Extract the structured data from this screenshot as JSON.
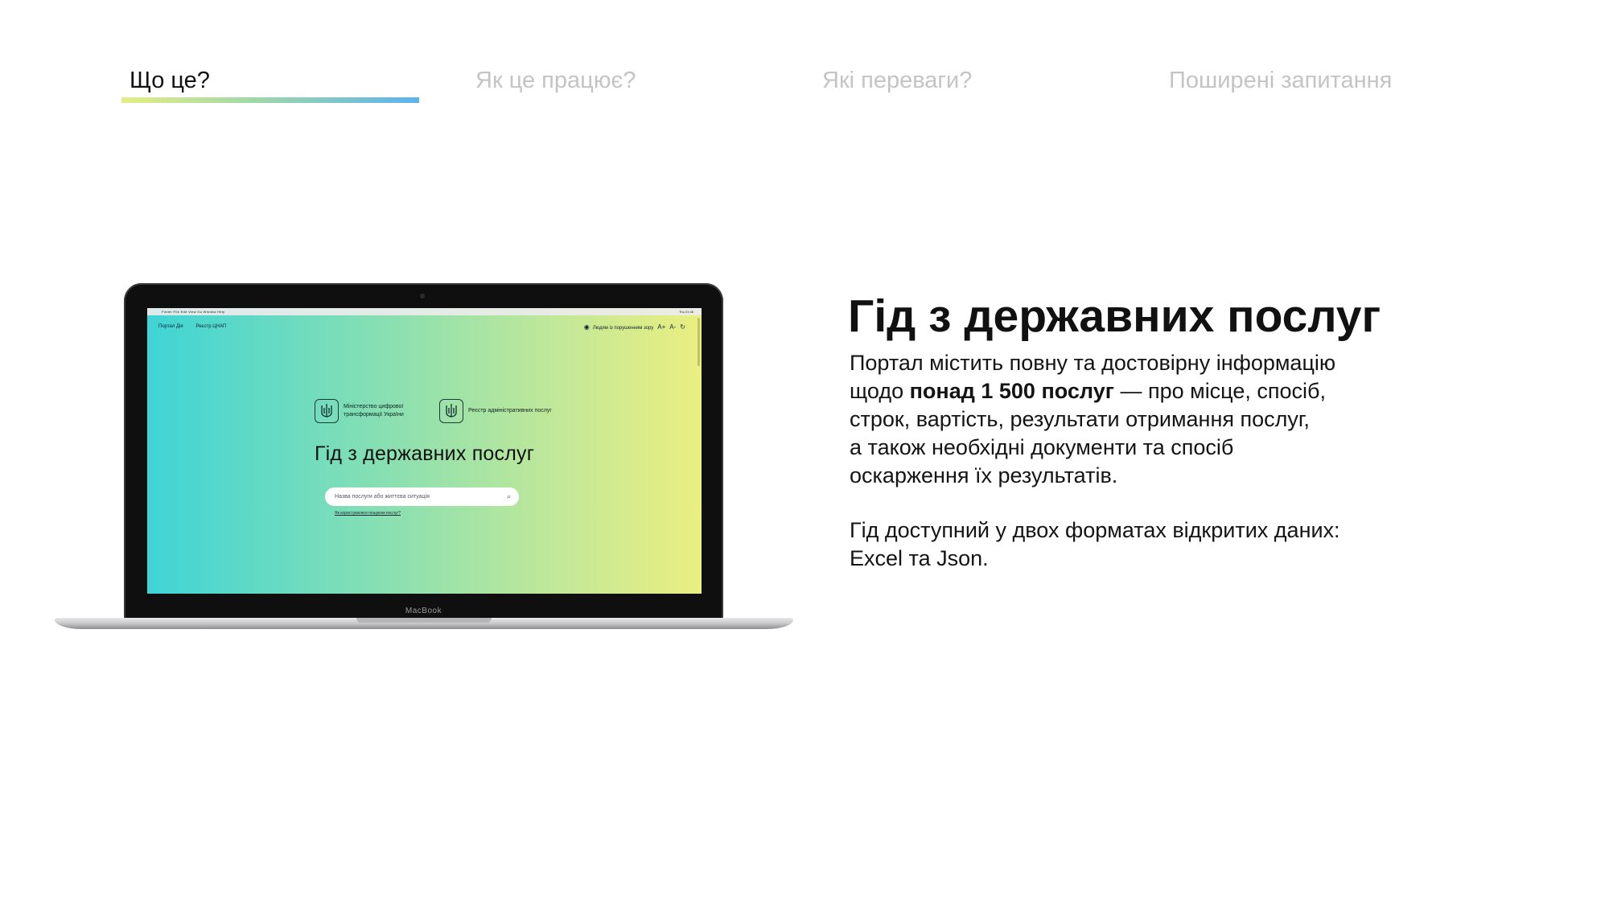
{
  "tabs": [
    {
      "label": "Що це?",
      "active": true
    },
    {
      "label": "Як це працює?",
      "active": false
    },
    {
      "label": "Які переваги?",
      "active": false
    },
    {
      "label": "Поширені запитання",
      "active": false
    }
  ],
  "colors": {
    "tab_underline": [
      "#e4ee84",
      "#9fd8a8",
      "#5db2ee"
    ],
    "inactive_tab": "#c4c4c4",
    "screen_gradient": [
      "#3fd4d6",
      "#8ce0b0",
      "#c4e898",
      "#eaef80"
    ]
  },
  "laptop": {
    "brand": "MacBook",
    "menubar": {
      "apple": "",
      "menus": "Finder  File  Edit  View  Go  Window  Help",
      "clock": "Thu 21:46"
    },
    "site": {
      "nav": [
        "Портал Дія",
        "Реєстр ЦНАП"
      ],
      "accessibility": "Людям із порушенням зору",
      "font_increase": "A+",
      "font_decrease": "A-",
      "reset": "↻",
      "logo1": "Міністерство цифрової трансформації України",
      "logo2": "Реєстр адміністративних послуг",
      "title": "Гід з державних послуг",
      "search_placeholder": "Назва послуги або життєва ситуація",
      "search_help": "Як користуватися пошуком послуг?"
    }
  },
  "content": {
    "headline": "Гід з державних послуг",
    "para1": {
      "line1": "Портал містить повну та достовірну інформацію",
      "line2_prefix": "щодо ",
      "line2_bold": "понад 1 500 послуг",
      "line2_suffix": " — про місце, спосіб,",
      "line3": "строк, вартість, результати отримання послуг,",
      "line4": "а також необхідні документи та спосіб",
      "line5": "оскарження їх результатів."
    },
    "para2": {
      "line1": "Гід доступний у двох форматах відкритих даних:",
      "line2": "Excel та Json."
    }
  }
}
